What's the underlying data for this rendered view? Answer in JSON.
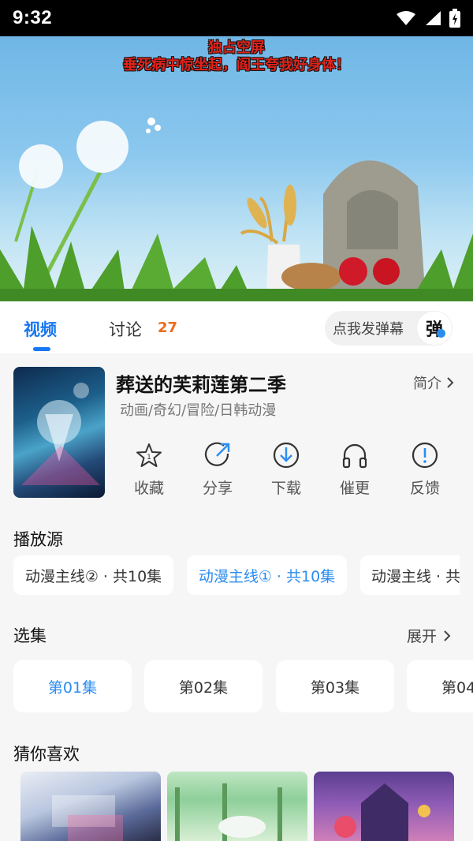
{
  "status_bar": {
    "time": "9:32"
  },
  "video": {
    "danmaku": [
      "独占空屏",
      "垂死病中惊坐起，阎王夸我好身体！"
    ]
  },
  "tabs": {
    "video_label": "视频",
    "discuss_label": "讨论",
    "discuss_count": "27",
    "danmaku_placeholder": "点我发弹幕",
    "danmaku_button": "弹"
  },
  "info": {
    "title": "葬送的芙莉莲第二季",
    "genres": "动画/奇幻/冒险/日韩动漫",
    "intro_label": "简介",
    "actions": [
      "收藏",
      "分享",
      "下载",
      "催更",
      "反馈"
    ]
  },
  "sources": {
    "title": "播放源",
    "items": [
      "动漫主线② · 共10集",
      "动漫主线① · 共10集",
      "动漫主线 · 共"
    ],
    "selected_index": 1
  },
  "episodes": {
    "title": "选集",
    "expand_label": "展开",
    "items": [
      "第01集",
      "第02集",
      "第03集",
      "第04"
    ],
    "selected_index": 0
  },
  "recommend": {
    "title": "猜你喜欢"
  },
  "colors": {
    "accent": "#1877f2",
    "count": "#f06a1c",
    "danmaku": "#e2231a"
  }
}
